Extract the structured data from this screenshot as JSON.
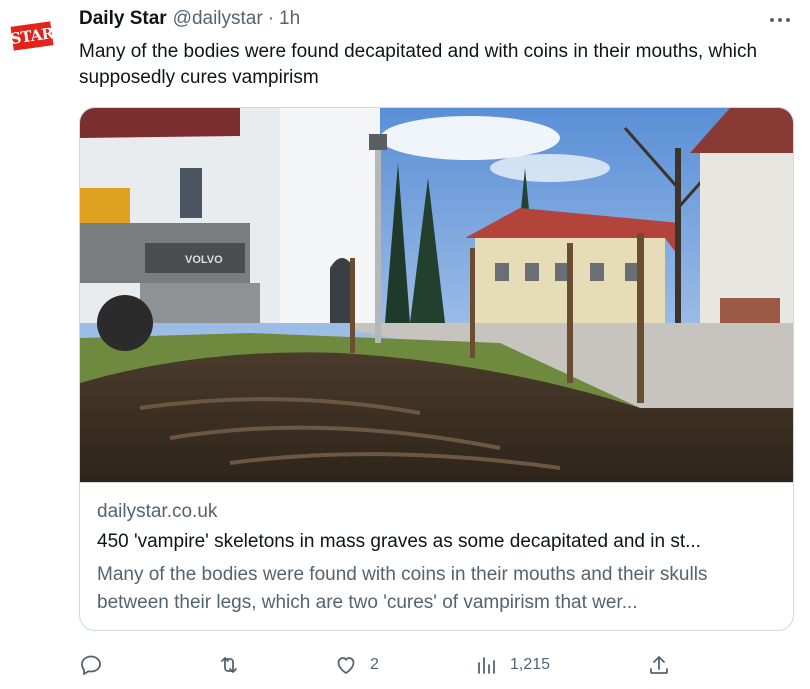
{
  "tweet": {
    "author_name": "Daily Star",
    "handle": "@dailystar",
    "separator": "·",
    "time": "1h",
    "avatar_text": "STAR",
    "text": "Many of the bodies were found decapitated and with coins in their mouths, which supposedly cures vampirism"
  },
  "card": {
    "domain": "dailystar.co.uk",
    "title": "450 'vampire' skeletons in mass graves as some decapitated and in st...",
    "description": "Many of the bodies were found with coins in their mouths and their skulls between their legs, which are two 'cures' of vampirism that wer...",
    "excavator_brand": "VOLVO"
  },
  "actions": {
    "reply_count": "",
    "retweet_count": "",
    "like_count": "2",
    "views_count": "1,215"
  },
  "colors": {
    "brand_red": "#e2231a",
    "text_primary": "#0f1419",
    "text_secondary": "#536471",
    "border": "#cfd9de"
  },
  "icons": [
    "more-icon",
    "reply-icon",
    "retweet-icon",
    "like-icon",
    "views-icon",
    "share-icon"
  ]
}
